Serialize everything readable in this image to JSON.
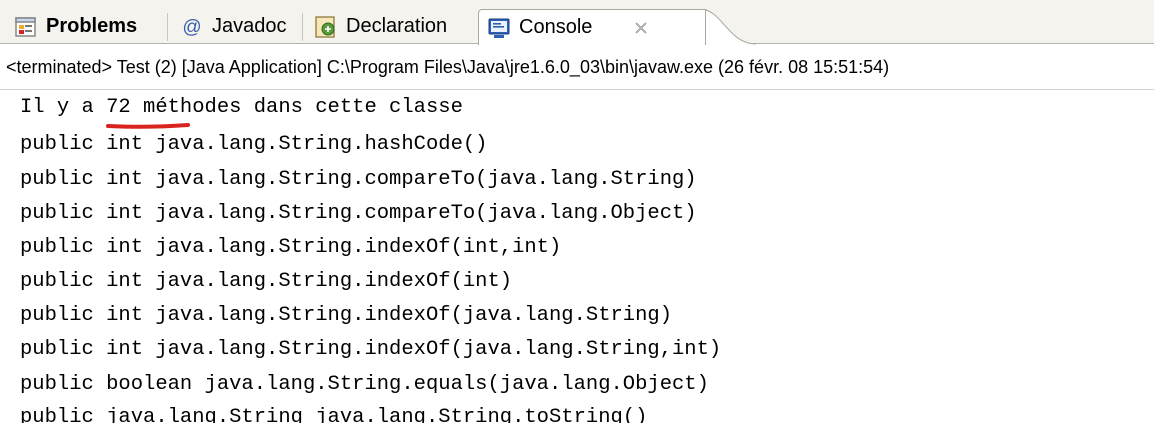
{
  "tabs": [
    {
      "label": "Problems",
      "icon": "problems-icon",
      "active": false
    },
    {
      "label": "Javadoc",
      "icon": "javadoc-at-icon",
      "active": false
    },
    {
      "label": "Declaration",
      "icon": "declaration-icon",
      "active": false
    },
    {
      "label": "Console",
      "icon": "console-icon",
      "active": true
    }
  ],
  "status_line": "<terminated> Test (2) [Java Application] C:\\Program Files\\Java\\jre1.6.0_03\\bin\\javaw.exe (26 févr. 08 15:51:54)",
  "console_lines": [
    "Il y a 72 méthodes dans cette classe",
    "public int java.lang.String.hashCode()",
    "public int java.lang.String.compareTo(java.lang.String)",
    "public int java.lang.String.compareTo(java.lang.Object)",
    "public int java.lang.String.indexOf(int,int)",
    "public int java.lang.String.indexOf(int)",
    "public int java.lang.String.indexOf(java.lang.String)",
    "public int java.lang.String.indexOf(java.lang.String,int)",
    "public boolean java.lang.String.equals(java.lang.Object)",
    "public java.lang.String java.lang.String.toString()"
  ],
  "colors": {
    "annotation_underline": "#d9231f",
    "tab_bar_bg": "#f4f3ee",
    "console_icon_blue": "#2d5fb5"
  }
}
